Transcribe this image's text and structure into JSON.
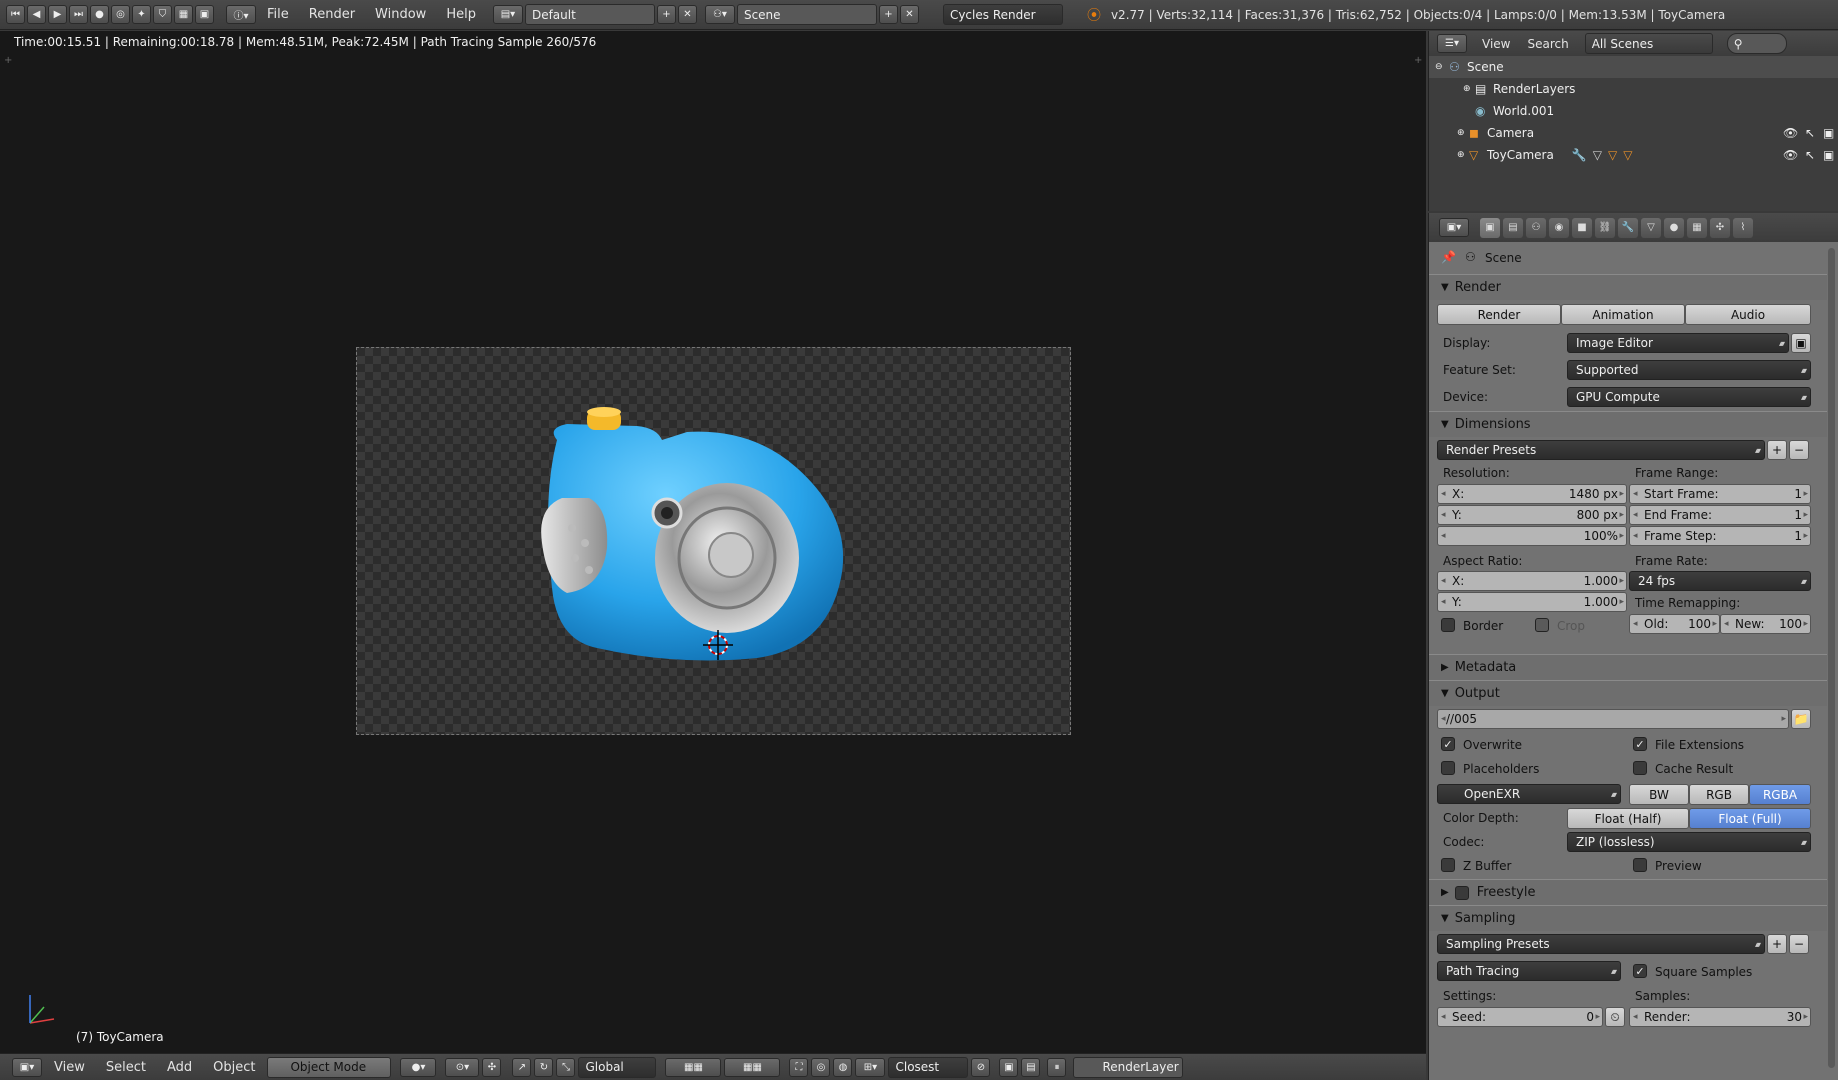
{
  "topbar": {
    "menus": [
      "File",
      "Render",
      "Window",
      "Help"
    ],
    "layout": "Default",
    "scene": "Scene",
    "engine": "Cycles Render",
    "stats": "v2.77 | Verts:32,114 | Faces:31,376 | Tris:62,752 | Objects:0/4 | Lamps:0/0 | Mem:13.53M | ToyCamera"
  },
  "viewport": {
    "info": "Time:00:15.51 | Remaining:00:18.78 | Mem:48.51M, Peak:72.45M | Path Tracing Sample 260/576",
    "object_label": "(7) ToyCamera"
  },
  "bottombar": {
    "menus": [
      "View",
      "Select",
      "Add",
      "Object"
    ],
    "mode": "Object Mode",
    "orientation": "Global",
    "snap": "Closest",
    "render_layer": "RenderLayer"
  },
  "outliner": {
    "menus": [
      "View",
      "Search"
    ],
    "filter": "All Scenes",
    "items": [
      "Scene",
      "RenderLayers",
      "World.001",
      "Camera",
      "ToyCamera"
    ]
  },
  "props": {
    "context": "Scene",
    "render": {
      "title": "Render",
      "btn_render": "Render",
      "btn_animation": "Animation",
      "btn_audio": "Audio",
      "display_label": "Display:",
      "display": "Image Editor",
      "feature_label": "Feature Set:",
      "feature": "Supported",
      "device_label": "Device:",
      "device": "GPU Compute"
    },
    "dimensions": {
      "title": "Dimensions",
      "presets": "Render Presets",
      "res_label": "Resolution:",
      "res_x_label": "X:",
      "res_x": "1480 px",
      "res_y_label": "Y:",
      "res_y": "800 px",
      "res_pct": "100%",
      "frame_range_label": "Frame Range:",
      "start_label": "Start Frame:",
      "start": "1",
      "end_label": "End Frame:",
      "end": "1",
      "step_label": "Frame Step:",
      "step": "1",
      "aspect_label": "Aspect Ratio:",
      "asp_x_label": "X:",
      "asp_x": "1.000",
      "asp_y_label": "Y:",
      "asp_y": "1.000",
      "frame_rate_label": "Frame Rate:",
      "fps": "24 fps",
      "remap_label": "Time Remapping:",
      "old_label": "Old:",
      "old": "100",
      "new_label": "New:",
      "new": "100",
      "border": "Border",
      "crop": "Crop"
    },
    "metadata": {
      "title": "Metadata"
    },
    "output": {
      "title": "Output",
      "path": "//005",
      "overwrite": "Overwrite",
      "file_ext": "File Extensions",
      "placeholders": "Placeholders",
      "cache": "Cache Result",
      "format": "OpenEXR",
      "bw": "BW",
      "rgb": "RGB",
      "rgba": "RGBA",
      "depth_label": "Color Depth:",
      "half": "Float (Half)",
      "full": "Float (Full)",
      "codec_label": "Codec:",
      "codec": "ZIP (lossless)",
      "zbuffer": "Z Buffer",
      "preview": "Preview"
    },
    "freestyle": {
      "title": "Freestyle"
    },
    "sampling": {
      "title": "Sampling",
      "presets": "Sampling Presets",
      "integrator": "Path Tracing",
      "square": "Square Samples",
      "settings_label": "Settings:",
      "samples_label": "Samples:",
      "seed_label": "Seed:",
      "seed": "0",
      "render_label": "Render:",
      "render": "30"
    }
  }
}
